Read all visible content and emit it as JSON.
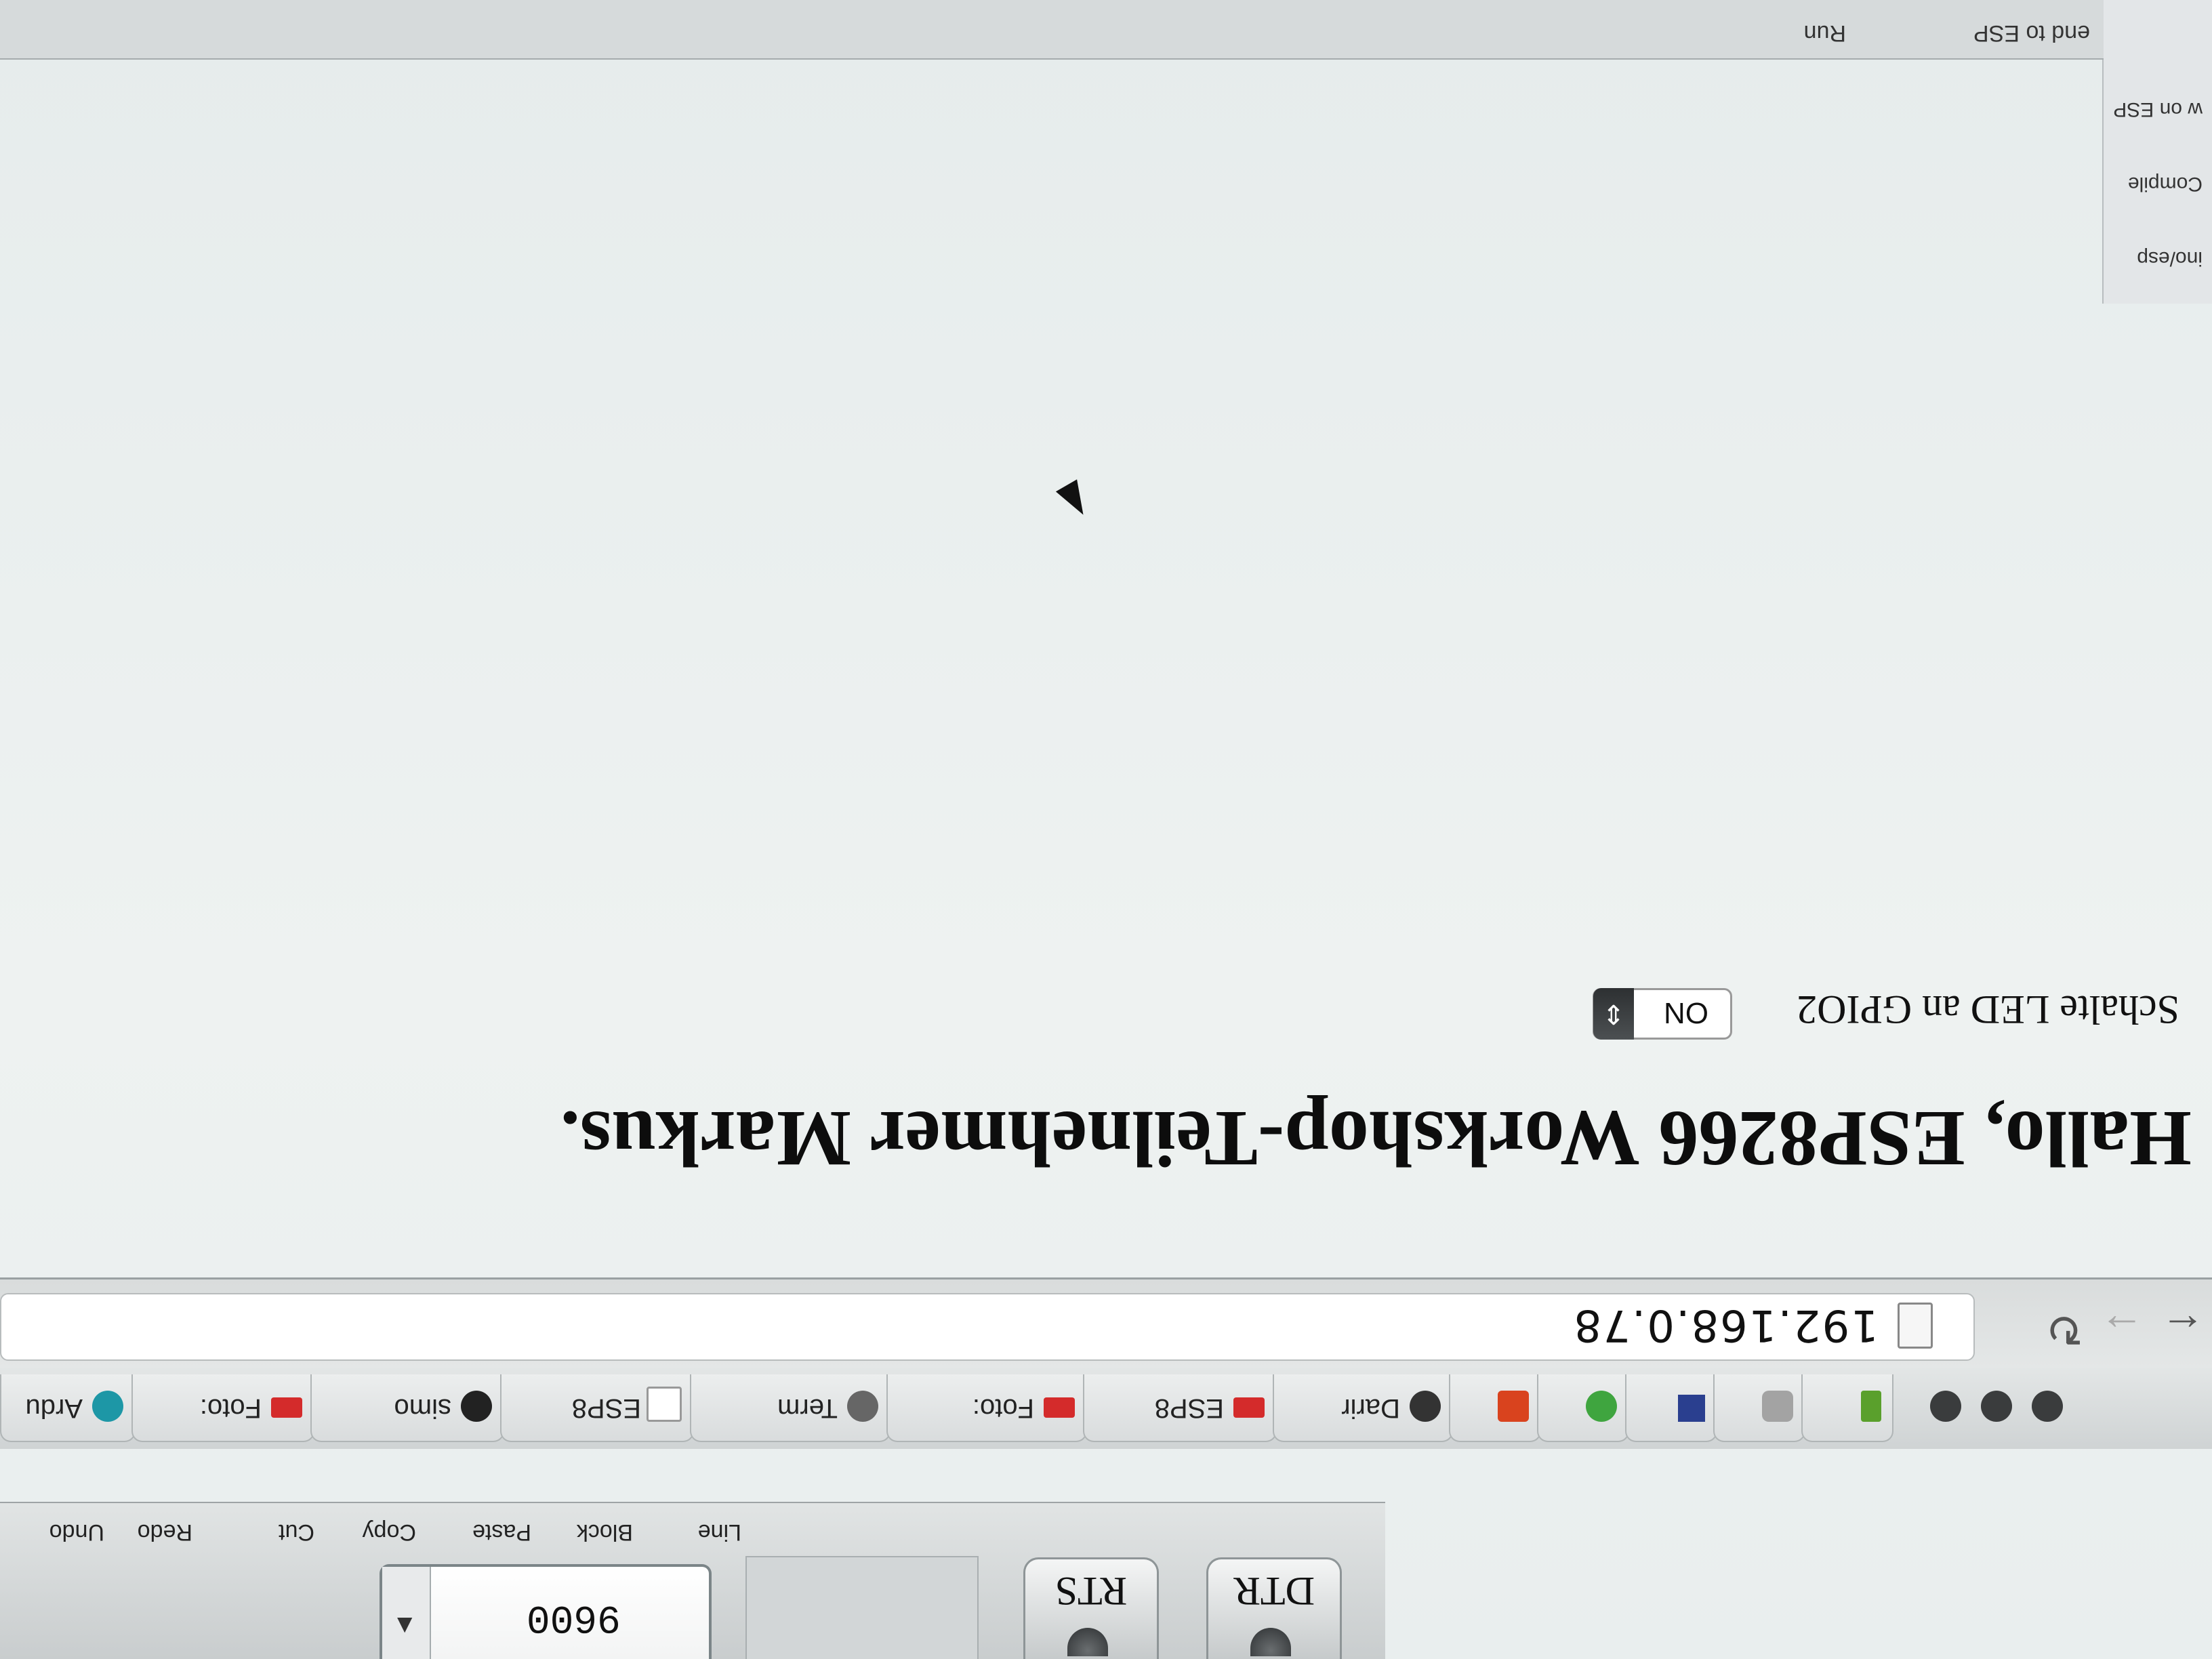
{
  "toolbar": {
    "undo": "Undo",
    "redo": "Redo",
    "cut": "Cut",
    "copy": "Copy",
    "paste": "Paste",
    "block": "Block",
    "line": "Line",
    "dtr": "DTR",
    "rts": "RTS",
    "baud": "9600",
    "baud_arrow": "▲"
  },
  "tabs": [
    {
      "label": "Ardu",
      "color": "#1d97a6"
    },
    {
      "label": "Foto:",
      "color": "#d42b2b"
    },
    {
      "label": "simo",
      "color": "#222222"
    },
    {
      "label": "ESP8",
      "color": "#bbbbbb"
    },
    {
      "label": "Term",
      "color": "#444444"
    },
    {
      "label": "Foto:",
      "color": "#d42b2b"
    },
    {
      "label": "ESP8",
      "color": "#d42b2b"
    },
    {
      "label": "Darir",
      "color": "#333333"
    },
    {
      "label": "",
      "color": "#d9431e"
    },
    {
      "label": "",
      "color": "#3fa53f"
    },
    {
      "label": "",
      "color": "#2a3f8f"
    },
    {
      "label": "",
      "color": "#a3a3a3"
    },
    {
      "label": "",
      "color": "#5aa02c"
    }
  ],
  "address": {
    "url": "192.168.0.78"
  },
  "page": {
    "headline": "Hallo, ESP8266 Workshop-Teilnehmer Markus.",
    "led_label": "Schalte LED an GPIO2",
    "led_value": "ON",
    "led_arrow": "⇕"
  },
  "side_panel": {
    "item1": "ino/esp",
    "item2": "Compile",
    "item3": "w on ESP",
    "item4": "end to ESP",
    "item5": "Run"
  }
}
